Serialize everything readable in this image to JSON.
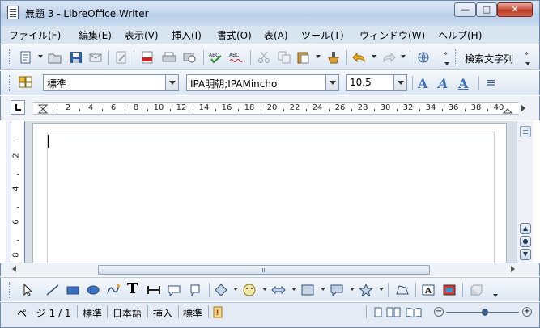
{
  "window": {
    "title": "無題 3 - LibreOffice Writer",
    "minimize_glyph": "—",
    "maximize_glyph": "□",
    "close_glyph": "✕"
  },
  "menubar": {
    "items": [
      "ファイル(F)",
      "編集(E)",
      "表示(V)",
      "挿入(I)",
      "書式(O)",
      "表(A)",
      "ツール(T)",
      "ウィンドウ(W)",
      "ヘルプ(H)"
    ]
  },
  "toolbar_standard": {
    "search_label": "検索文字列"
  },
  "toolbar_formatting": {
    "paragraph_style": "標準",
    "font_name": "IPA明朝;IPAMincho",
    "font_size": "10.5",
    "align_glyph": "≡"
  },
  "ruler": {
    "horizontal_labels": [
      "2",
      "4",
      "6",
      "8",
      "10",
      "12",
      "14",
      "16",
      "18",
      "20",
      "22",
      "24",
      "26",
      "28",
      "30",
      "32",
      "34",
      "36",
      "38",
      "40"
    ],
    "vertical_labels": [
      "2",
      "4",
      "6",
      "8"
    ]
  },
  "navigation": {
    "prev_glyph": "▲",
    "center_glyph": "●",
    "next_glyph": "▼"
  },
  "statusbar": {
    "page": "ページ 1 / 1",
    "page_style": "標準",
    "language": "日本語",
    "insert_mode": "挿入",
    "selection_mode": "標準",
    "zoom_minus": "−",
    "zoom_plus": "+"
  },
  "colors": {
    "title_bar": "#c3d5ec",
    "menu_bar": "#d9e4f1",
    "close_button": "#c94f3a",
    "document_background": "#d8dee7"
  }
}
